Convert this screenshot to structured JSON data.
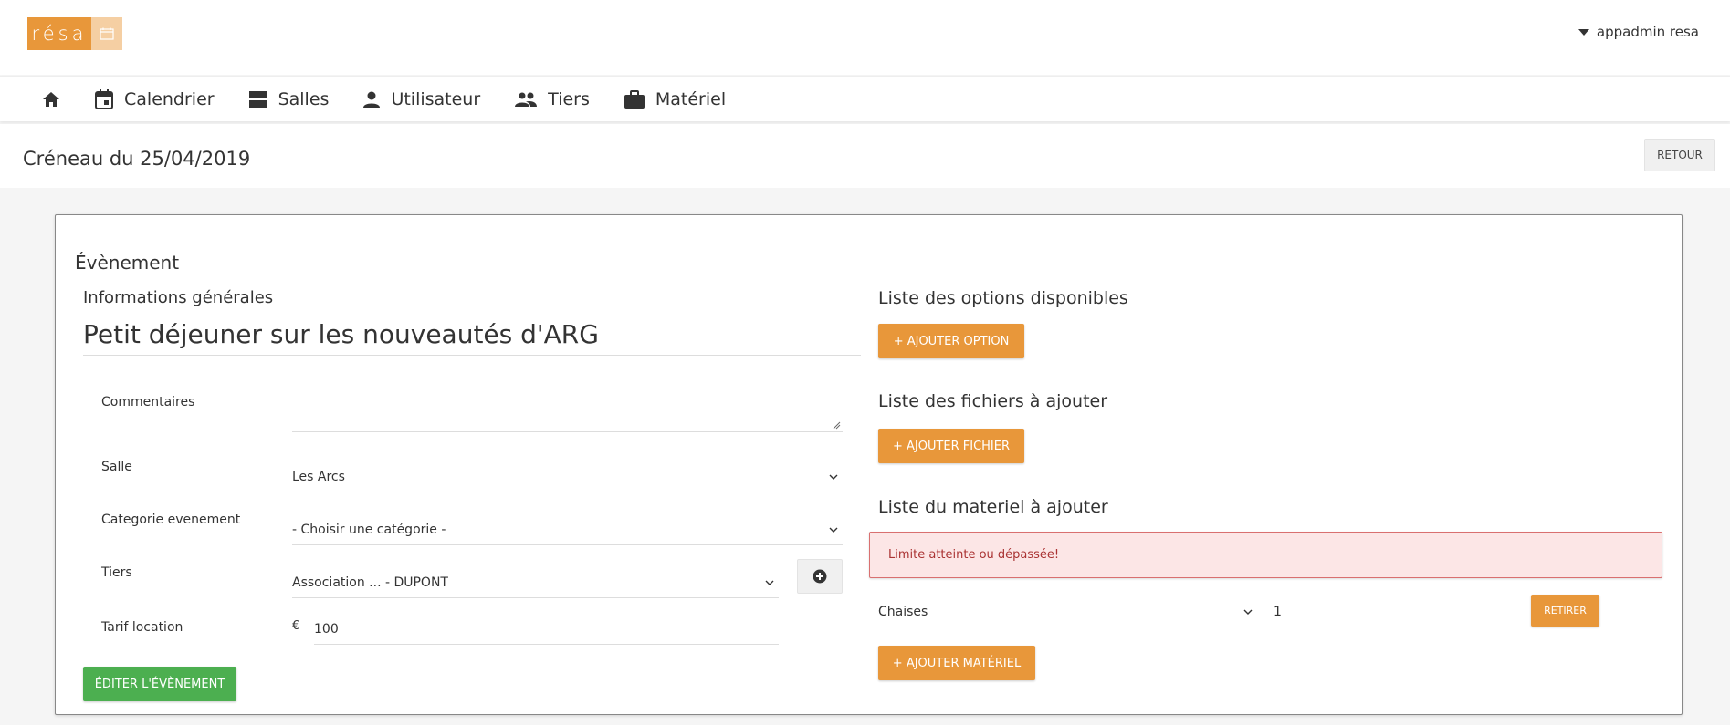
{
  "header": {
    "logo_text": "résa",
    "user_name": "appadmin resa",
    "brand_color": "#e8973a"
  },
  "nav": {
    "items": [
      {
        "icon": "home-icon",
        "label": ""
      },
      {
        "icon": "calendar-icon",
        "label": "Calendrier"
      },
      {
        "icon": "rooms-icon",
        "label": "Salles"
      },
      {
        "icon": "user-icon",
        "label": "Utilisateur"
      },
      {
        "icon": "group-icon",
        "label": "Tiers"
      },
      {
        "icon": "briefcase-icon",
        "label": "Matériel"
      }
    ]
  },
  "page": {
    "title": "Créneau du 25/04/2019",
    "back_label": "RETOUR"
  },
  "event": {
    "card_title": "Évènement",
    "general_section": "Informations générales",
    "name": "Petit déjeuner sur les nouveautés d'ARG",
    "fields": {
      "comments_label": "Commentaires",
      "comments_value": "",
      "room_label": "Salle",
      "room_value": "Les Arcs",
      "category_label": "Categorie evenement",
      "category_value": "- Choisir une catégorie -",
      "third_party_label": "Tiers",
      "third_party_value": "Association ... - DUPONT",
      "price_label": "Tarif location",
      "price_currency": "€",
      "price_value": "100"
    },
    "edit_button": "ÉDITER L'ÉVÈNEMENT"
  },
  "options": {
    "section": "Liste des options disponibles",
    "add_button": "+ AJOUTER OPTION"
  },
  "files": {
    "section": "Liste des fichiers à ajouter",
    "add_button": "+ AJOUTER FICHIER"
  },
  "equipment": {
    "section": "Liste du materiel à ajouter",
    "alert": "Limite atteinte ou dépassée!",
    "item_name": "Chaises",
    "item_qty": "1",
    "remove_button": "RETIRER",
    "add_button": "+ AJOUTER MATÉRIEL"
  }
}
